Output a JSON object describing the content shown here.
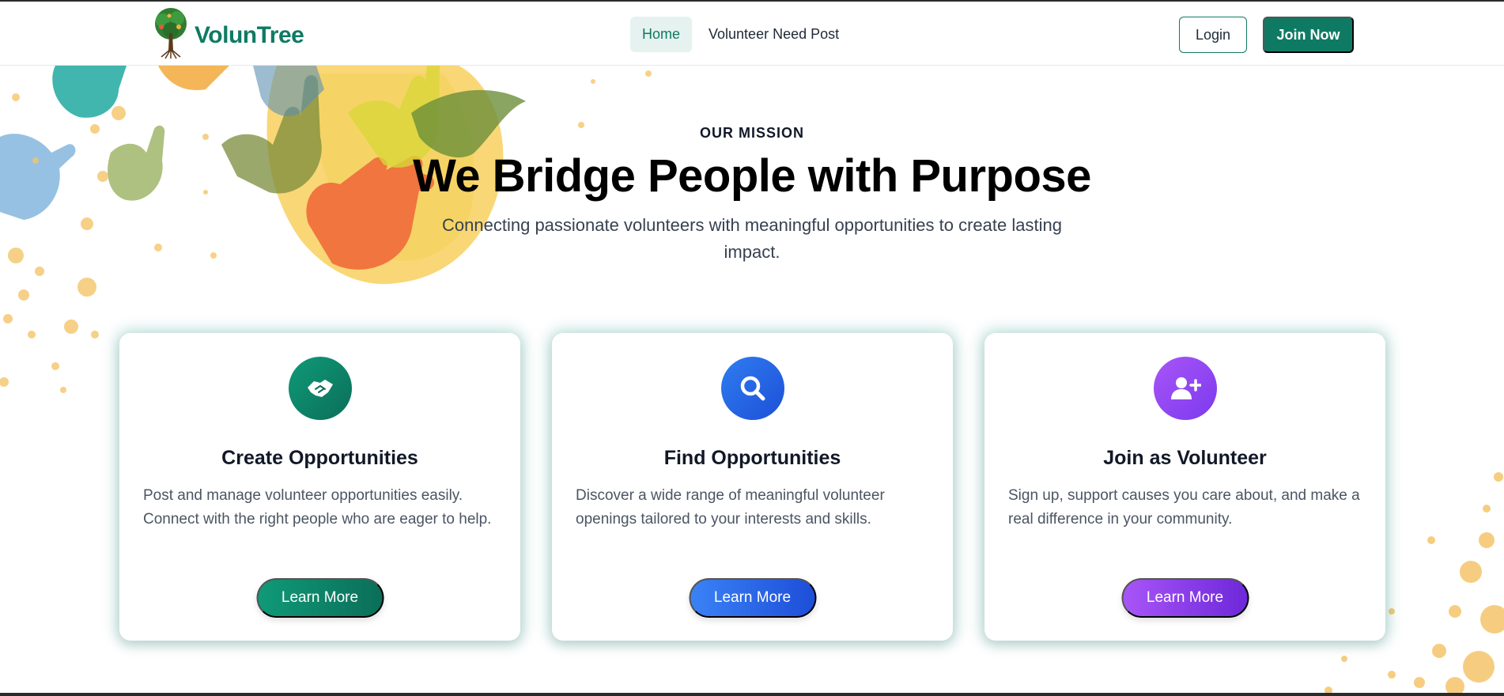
{
  "brand": {
    "name": "VolunTree",
    "logo_icon": "tree-icon",
    "color": "#0f7a63"
  },
  "nav": {
    "links": [
      {
        "label": "Home",
        "active": true
      },
      {
        "label": "Volunteer Need Post",
        "active": false
      }
    ],
    "login_label": "Login",
    "join_label": "Join Now"
  },
  "hero": {
    "eyebrow": "OUR MISSION",
    "title": "We Bridge People with Purpose",
    "subtitle": "Connecting passionate volunteers with meaningful opportunities to create lasting impact."
  },
  "cards": [
    {
      "icon": "handshake-icon",
      "accent": "#0f7a63",
      "title": "Create Opportunities",
      "text": "Post and manage volunteer opportunities easily. Connect with the right people who are eager to help.",
      "button": "Learn More"
    },
    {
      "icon": "search-icon",
      "accent": "#2563eb",
      "title": "Find Opportunities",
      "text": "Discover a wide range of meaningful volunteer openings tailored to your interests and skills.",
      "button": "Learn More"
    },
    {
      "icon": "user-plus-icon",
      "accent": "#8b5cf6",
      "title": "Join as Volunteer",
      "text": "Sign up, support causes you care about, and make a real difference in your community.",
      "button": "Learn More"
    }
  ]
}
